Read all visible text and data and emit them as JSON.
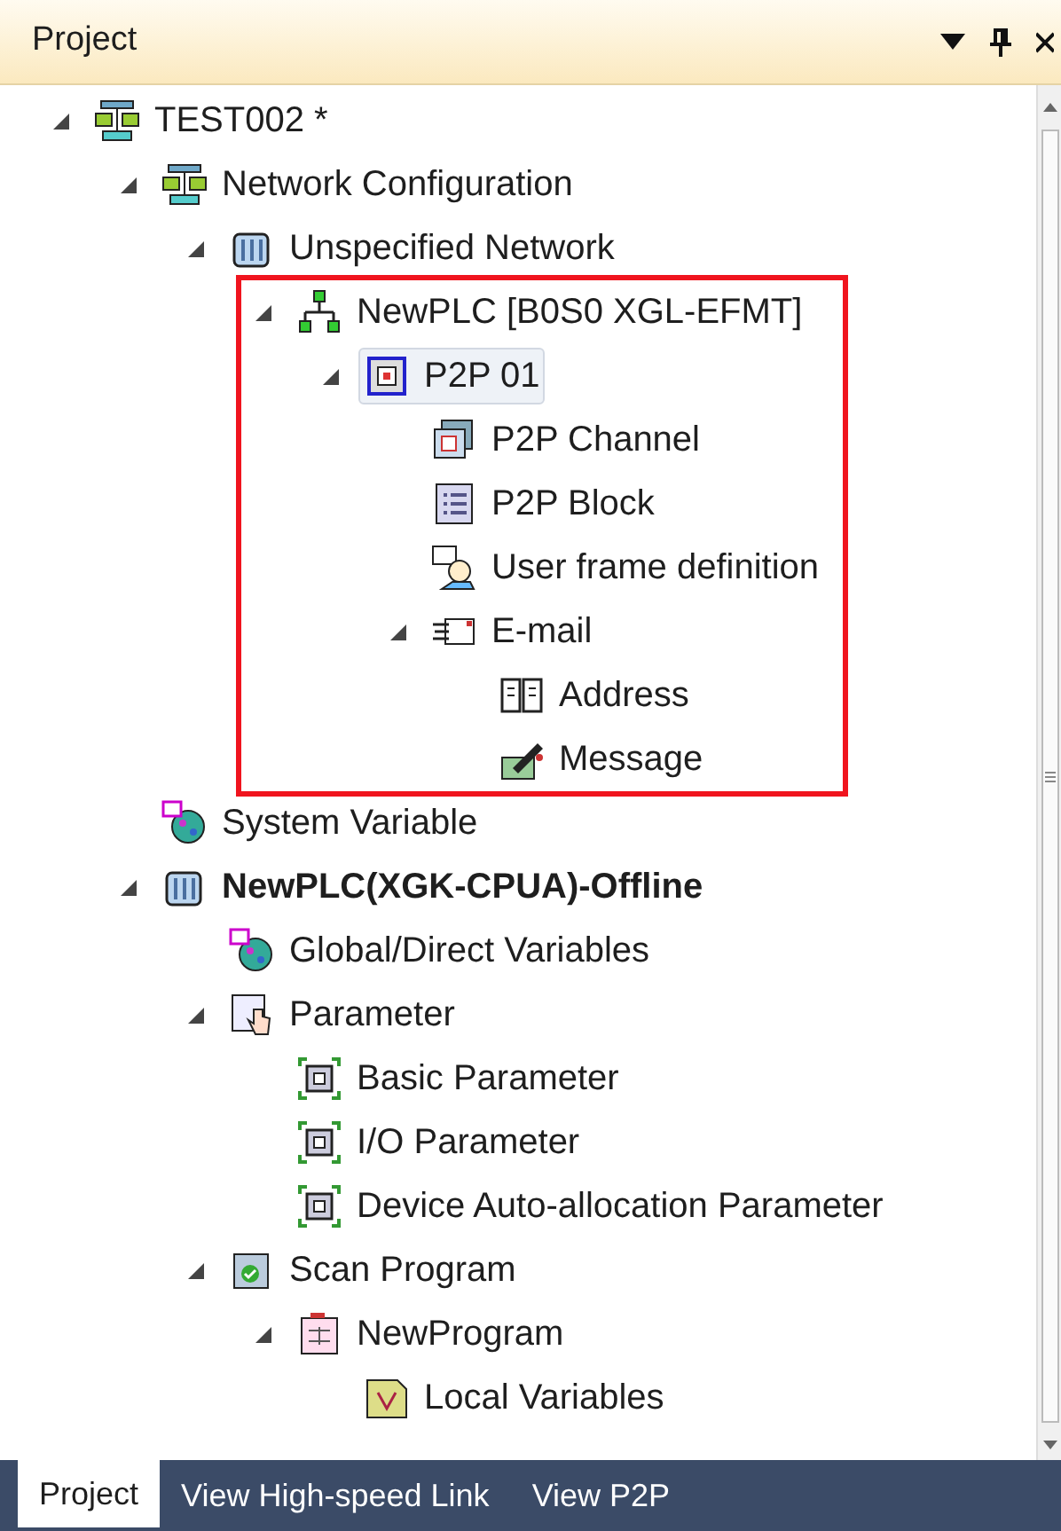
{
  "panel": {
    "title": "Project"
  },
  "tree": [
    {
      "label": "TEST002 *",
      "kind": "project",
      "expanded": true,
      "selected": false,
      "children": [
        {
          "label": "Network Configuration",
          "kind": "project",
          "expanded": true,
          "selected": false,
          "children": [
            {
              "label": "Unspecified Network",
              "kind": "station",
              "expanded": true,
              "selected": false,
              "children": [
                {
                  "label": "NewPLC [B0S0 XGL-EFMT]",
                  "kind": "network",
                  "expanded": true,
                  "selected": false,
                  "highlighted": true,
                  "children": [
                    {
                      "label": "P2P 01",
                      "kind": "p2p",
                      "expanded": true,
                      "selected": true,
                      "children": [
                        {
                          "label": "P2P Channel",
                          "kind": "channel",
                          "selected": false
                        },
                        {
                          "label": "P2P Block",
                          "kind": "block",
                          "selected": false
                        },
                        {
                          "label": "User frame definition",
                          "kind": "userframe",
                          "selected": false
                        },
                        {
                          "label": "E-mail",
                          "kind": "email",
                          "expanded": true,
                          "selected": false,
                          "children": [
                            {
                              "label": "Address",
                              "kind": "address",
                              "selected": false
                            },
                            {
                              "label": "Message",
                              "kind": "message",
                              "selected": false
                            }
                          ]
                        }
                      ]
                    }
                  ]
                }
              ]
            }
          ]
        },
        {
          "label": "System Variable",
          "kind": "variables",
          "selected": false
        },
        {
          "label": "NewPLC(XGK-CPUA)-Offline",
          "kind": "station",
          "expanded": true,
          "selected": false,
          "bold": true,
          "children": [
            {
              "label": "Global/Direct Variables",
              "kind": "variables",
              "selected": false
            },
            {
              "label": "Parameter",
              "kind": "parameter",
              "expanded": true,
              "selected": false,
              "children": [
                {
                  "label": "Basic Parameter",
                  "kind": "param",
                  "selected": false
                },
                {
                  "label": "I/O Parameter",
                  "kind": "param",
                  "selected": false
                },
                {
                  "label": "Device Auto-allocation Parameter",
                  "kind": "param",
                  "selected": false
                }
              ]
            },
            {
              "label": "Scan Program",
              "kind": "scan",
              "expanded": true,
              "selected": false,
              "children": [
                {
                  "label": "NewProgram",
                  "kind": "program",
                  "expanded": true,
                  "selected": false,
                  "children": [
                    {
                      "label": "Local Variables",
                      "kind": "local",
                      "selected": false
                    }
                  ]
                }
              ]
            }
          ]
        }
      ]
    }
  ],
  "tabs": [
    {
      "label": "Project",
      "selected": true
    },
    {
      "label": "View High-speed Link",
      "selected": false
    },
    {
      "label": "View P2P",
      "selected": false
    }
  ]
}
